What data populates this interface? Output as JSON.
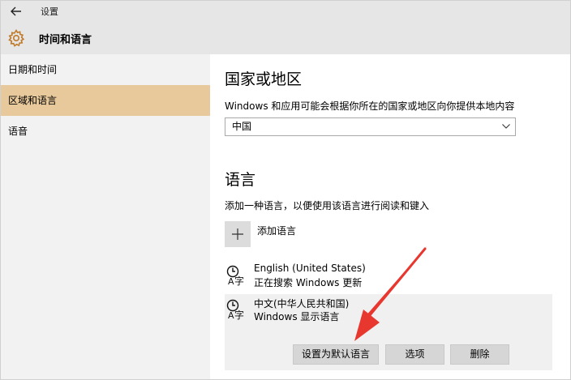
{
  "header": {
    "window_title": "设置",
    "section_title": "时间和语言",
    "back_icon": "back-arrow-icon",
    "section_icon": "gear-icon"
  },
  "sidebar": {
    "items": [
      {
        "label": "日期和时间",
        "active": false
      },
      {
        "label": "区域和语言",
        "active": true
      },
      {
        "label": "语音",
        "active": false
      }
    ],
    "active_color": "#e7c99b"
  },
  "region": {
    "heading": "国家或地区",
    "description": "Windows 和应用可能会根据你所在的国家或地区向你提供本地内容",
    "selected_value": "中国"
  },
  "language": {
    "heading": "语言",
    "description": "添加一种语言，以便使用该语言进行阅读和键入",
    "add_label": "添加语言",
    "items": [
      {
        "name": "English (United States)",
        "status": "正在搜索 Windows 更新"
      },
      {
        "name": "中文(中华人民共和国)",
        "status": "Windows 显示语言"
      }
    ],
    "actions": {
      "set_default": "设置为默认语言",
      "options": "选项",
      "remove": "删除"
    }
  },
  "annotation": {
    "arrow_color": "#e8372f"
  }
}
